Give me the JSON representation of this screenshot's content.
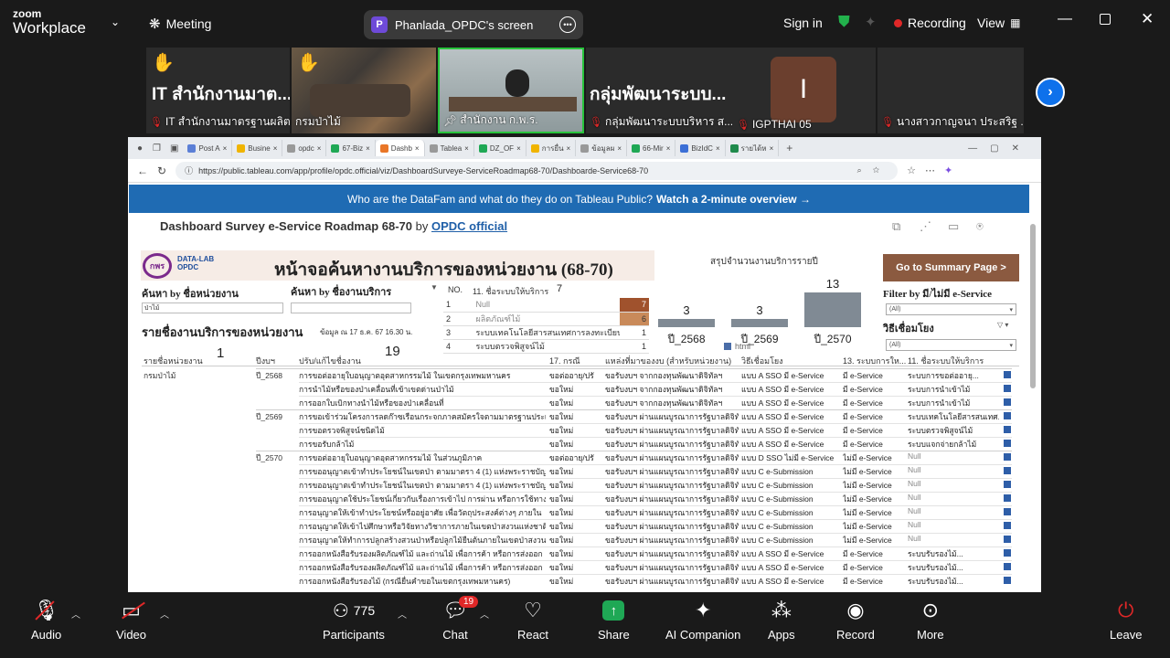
{
  "app": {
    "logo_top": "zoom",
    "logo_bottom": "Workplace",
    "meeting": "Meeting",
    "share_label": "Phanlada_OPDC's screen",
    "share_initial": "P",
    "sign_in": "Sign in",
    "recording": "Recording",
    "view": "View"
  },
  "thumbnails": [
    {
      "big": "IT สำนักงานมาต...",
      "name": "IT สำนักงานมาตรฐานผลิต...",
      "hand": true
    },
    {
      "big": "",
      "name": "กรมป่าไม้",
      "hand": true
    },
    {
      "big": "",
      "name": "สำนักงาน ก.พ.ร.",
      "hand": false
    },
    {
      "big": "กลุ่มพัฒนาระบบ...",
      "name": "กลุ่มพัฒนาระบบบริหาร ส...",
      "hand": false
    },
    {
      "big": "I",
      "name": "IGPTHAI 05",
      "hand": false
    },
    {
      "big": "",
      "name": "นางสาวกาญจนา ประสริฐ ...",
      "hand": false
    }
  ],
  "browser": {
    "tabs": [
      "Post A",
      "Busine",
      "opdc",
      "67-Biz",
      "Dashb",
      "Tablea",
      "DZ_OF",
      "การยื่น",
      "ข้อมูลผ",
      "66-Mir",
      "BizIdC",
      "รายได้ห"
    ],
    "url": "https://public.tableau.com/app/profile/opdc.official/viz/DashboardSurveye-ServiceRoadmap68-70/Dashboarde-Service68-70",
    "banner_q": "Who are the DataFam and what do they do on Tableau Public?",
    "banner_cta": "Watch a 2-minute overview →",
    "title": "Dashboard Survey e-Service Roadmap 68-70",
    "by": "by",
    "author": "OPDC official"
  },
  "viz": {
    "logo1": "กพร",
    "logo2": "DATA-LAB",
    "logo3": "OPDC",
    "thai_title": "หน้าจอค้นหางานบริการของหน่วยงาน (68-70)",
    "search_agency_label": "ค้นหา by ชื่อหน่วยงาน",
    "search_agency_value": "ป่าไม้",
    "search_service_label": "ค้นหา by ชื่องานบริการ",
    "list_title": "รายชื่องานบริการของหน่วยงาน",
    "updated": "ข้อมูล ณ 17 ธ.ค. 67 16.30 น.",
    "no_label": "NO.",
    "null_header": "11. ชื่อระบบให้บริการ",
    "null_count": "7",
    "null_rows": [
      [
        "1",
        "Null",
        "7"
      ],
      [
        "2",
        "ผลิตภัณฑ์ไม้",
        "6"
      ],
      [
        "3",
        "ระบบเทคโนโลยีสารสนเทศการลงทะเบียน...",
        "1"
      ],
      [
        "4",
        "ระบบตรวจพิสูจน์ไม้",
        "1"
      ]
    ],
    "summary_title": "สรุปจำนวนงานบริการรายปี",
    "summary": [
      {
        "year": "ปี_2568",
        "count": 3
      },
      {
        "year": "ปี_2569",
        "count": 3
      },
      {
        "year": "ปี_2570",
        "count": 13
      }
    ],
    "legend_html": "html",
    "go_summary": "Go to Summary Page >",
    "filter_label": "Filter by มี/ไม่มี e-Service",
    "filter_value": "(All)",
    "connect_label": "วิธีเชื่อมโยง",
    "connect_value": "(All)",
    "agency_count": "1",
    "service_count": "19",
    "headers": [
      "รายชื่อหน่วยงาน",
      "ปีงบฯ",
      "ปรับ/แก้ไขชื่องาน",
      "17. กรณี",
      "แหล่งที่มาของงบ (สำหรับหน่วยงาน)",
      "วิธีเชื่อมโยง",
      "13. ระบบการให...",
      "11. ชื่อระบบให้บริการ"
    ],
    "agency": "กรมป่าไม้",
    "rows": [
      {
        "year": "ปี_2568",
        "svc": "การขอต่ออายุใบอนุญาตอุตสาหกรรมไม้ ในเขตกรุงเทพมหานคร",
        "c17": "ขอต่ออายุ/ปรั",
        "src": "ขอรับงบฯ จากกองทุนพัฒนาดิจิทัลฯ",
        "conn": "แบบ A SSO มี e-Service",
        "c13": "มี e-Service",
        "c11": "ระบบการขอต่ออายุ..."
      },
      {
        "year": "",
        "svc": "การนำไม้หรือของป่าเคลื่อนที่เข้าเขตด่านป่าไม้",
        "c17": "ขอใหม่",
        "src": "ขอรับงบฯ จากกองทุนพัฒนาดิจิทัลฯ",
        "conn": "แบบ A SSO มี e-Service",
        "c13": "มี e-Service",
        "c11": "ระบบการนำเข้าไม้"
      },
      {
        "year": "",
        "svc": "การออกใบเบิกทางนำไม้หรือของป่าเคลื่อนที่",
        "c17": "ขอใหม่",
        "src": "ขอรับงบฯ จากกองทุนพัฒนาดิจิทัลฯ",
        "conn": "แบบ A SSO มี e-Service",
        "c13": "มี e-Service",
        "c11": "ระบบการนำเข้าไม้"
      },
      {
        "year": "ปี_2569",
        "svc": "การขอเข้าร่วมโครงการลดก๊าซเรือนกระจกภาคสมัครใจตามมาตรฐานประเทศไทย",
        "c17": "ขอใหม่",
        "src": "ขอรับงบฯ ผ่านแผนบูรณาการรัฐบาลดิจิทัล",
        "conn": "แบบ A SSO มี e-Service",
        "c13": "มี e-Service",
        "c11": "ระบบเทคโนโลยีสารสนเทศ..."
      },
      {
        "year": "",
        "svc": "การขอตรวจพิสูจน์ชนิดไม้",
        "c17": "ขอใหม่",
        "src": "ขอรับงบฯ ผ่านแผนบูรณาการรัฐบาลดิจิทัล",
        "conn": "แบบ A SSO มี e-Service",
        "c13": "มี e-Service",
        "c11": "ระบบตรวจพิสูจน์ไม้"
      },
      {
        "year": "",
        "svc": "การขอรับกล้าไม้",
        "c17": "ขอใหม่",
        "src": "ขอรับงบฯ ผ่านแผนบูรณาการรัฐบาลดิจิทัล",
        "conn": "แบบ A SSO มี e-Service",
        "c13": "มี e-Service",
        "c11": "ระบบแจกจ่ายกล้าไม้"
      },
      {
        "year": "ปี_2570",
        "svc": "การขอต่ออายุใบอนุญาตอุตสาหกรรมไม้ ในส่วนภูมิภาค",
        "c17": "ขอต่ออายุ/ปรั",
        "src": "ขอรับงบฯ ผ่านแผนบูรณาการรัฐบาลดิจิทัล",
        "conn": "แบบ D SSO ไม่มี e-Service",
        "c13": "ไม่มี e-Service",
        "c11": "Null"
      },
      {
        "year": "",
        "svc": "การขออนุญาตเข้าทำประโยชน์ในเขตป่า ตามมาตรา 4 (1) แห่งพระราชบัญญัติ",
        "c17": "ขอใหม่",
        "src": "ขอรับงบฯ ผ่านแผนบูรณาการรัฐบาลดิจิทัล",
        "conn": "แบบ C e-Submission",
        "c13": "ไม่มี e-Service",
        "c11": "Null"
      },
      {
        "year": "",
        "svc": "การขออนุญาตเข้าทำประโยชน์ในเขตป่า ตามมาตรา 4 (1) แห่งพระราชบัญญัติ",
        "c17": "ขอใหม่",
        "src": "ขอรับงบฯ ผ่านแผนบูรณาการรัฐบาลดิจิทัล",
        "conn": "แบบ C e-Submission",
        "c13": "ไม่มี e-Service",
        "c11": "Null"
      },
      {
        "year": "",
        "svc": "การขออนุญาตใช้ประโยชน์เกี่ยวกับเรื่องการเข้าไป การผ่าน หรือการใช้ทาง",
        "c17": "ขอใหม่",
        "src": "ขอรับงบฯ ผ่านแผนบูรณาการรัฐบาลดิจิทัล",
        "conn": "แบบ C e-Submission",
        "c13": "ไม่มี e-Service",
        "c11": "Null"
      },
      {
        "year": "",
        "svc": "การอนุญาตให้เข้าทำประโยชน์หรืออยู่อาศัย เพื่อวัตถุประสงค์ต่างๆ ภายใน",
        "c17": "ขอใหม่",
        "src": "ขอรับงบฯ ผ่านแผนบูรณาการรัฐบาลดิจิทัล",
        "conn": "แบบ C e-Submission",
        "c13": "ไม่มี e-Service",
        "c11": "Null"
      },
      {
        "year": "",
        "svc": "การอนุญาตให้เข้าไปศึกษาหรือวิจัยทางวิชาการภายในเขตป่าสงวนแห่งชาติ",
        "c17": "ขอใหม่",
        "src": "ขอรับงบฯ ผ่านแผนบูรณาการรัฐบาลดิจิทัล",
        "conn": "แบบ C e-Submission",
        "c13": "ไม่มี e-Service",
        "c11": "Null"
      },
      {
        "year": "",
        "svc": "การอนุญาตให้ทำการปลูกสร้างสวนป่าหรือปลูกไม้ยืนต้นภายในเขตป่าสงวน",
        "c17": "ขอใหม่",
        "src": "ขอรับงบฯ ผ่านแผนบูรณาการรัฐบาลดิจิทัล",
        "conn": "แบบ C e-Submission",
        "c13": "ไม่มี e-Service",
        "c11": "Null"
      },
      {
        "year": "",
        "svc": "การออกหนังสือรับรองผลิตภัณฑ์ไม้ และถ่านไม้ เพื่อการค้า หรือการส่งออก",
        "c17": "ขอใหม่",
        "src": "ขอรับงบฯ ผ่านแผนบูรณาการรัฐบาลดิจิทัล",
        "conn": "แบบ A SSO มี e-Service",
        "c13": "มี e-Service",
        "c11": "ระบบรับรองไม้..."
      },
      {
        "year": "",
        "svc": "การออกหนังสือรับรองผลิตภัณฑ์ไม้ และถ่านไม้ เพื่อการค้า หรือการส่งออก",
        "c17": "ขอใหม่",
        "src": "ขอรับงบฯ ผ่านแผนบูรณาการรัฐบาลดิจิทัล",
        "conn": "แบบ A SSO มี e-Service",
        "c13": "มี e-Service",
        "c11": "ระบบรับรองไม้..."
      },
      {
        "year": "",
        "svc": "การออกหนังสือรับรองไม้ (กรณียื่นคำขอในเขตกรุงเทพมหานคร)",
        "c17": "ขอใหม่",
        "src": "ขอรับงบฯ ผ่านแผนบูรณาการรัฐบาลดิจิทัล",
        "conn": "แบบ A SSO มี e-Service",
        "c13": "มี e-Service",
        "c11": "ระบบรับรองไม้..."
      }
    ]
  },
  "toolbar": {
    "audio": "Audio",
    "video": "Video",
    "participants": "Participants",
    "participants_count": "775",
    "chat": "Chat",
    "chat_badge": "19",
    "react": "React",
    "share": "Share",
    "ai": "AI Companion",
    "apps": "Apps",
    "record": "Record",
    "more": "More",
    "leave": "Leave"
  },
  "colors": {
    "accent": "#1f6bb3",
    "share_green": "#1fa855",
    "record_red": "#e02828",
    "summary_btn": "#8b5a40"
  }
}
